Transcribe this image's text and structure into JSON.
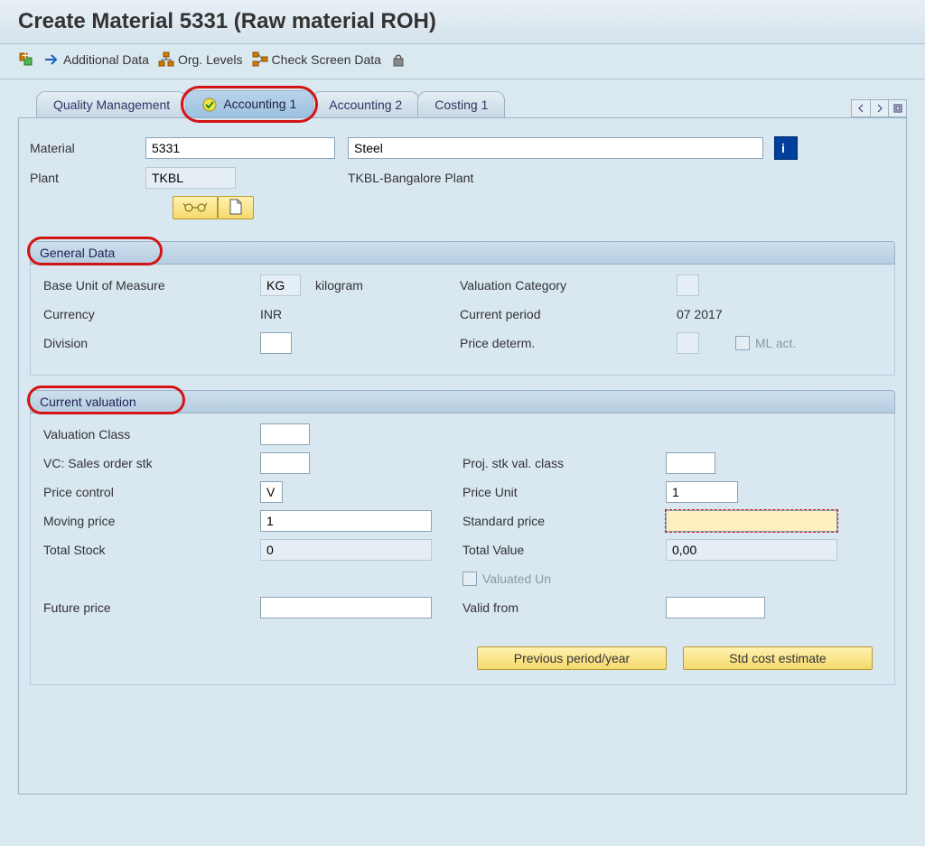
{
  "title": "Create Material 5331 (Raw material ROH)",
  "toolbar": {
    "additional_data": "Additional Data",
    "org_levels": "Org. Levels",
    "check_screen": "Check Screen Data"
  },
  "tabs": {
    "t1": "Quality Management",
    "t2": "Accounting 1",
    "t3": "Accounting 2",
    "t4": "Costing 1"
  },
  "header": {
    "material_label": "Material",
    "material_value": "5331",
    "material_desc": "Steel",
    "plant_label": "Plant",
    "plant_value": "TKBL",
    "plant_desc": "TKBL-Bangalore Plant"
  },
  "sections": {
    "general": {
      "title": "General Data",
      "base_uom_label": "Base Unit of Measure",
      "base_uom_value": "KG",
      "base_uom_text": "kilogram",
      "valuation_cat_label": "Valuation Category",
      "valuation_cat_value": "",
      "currency_label": "Currency",
      "currency_value": "INR",
      "current_period_label": "Current period",
      "current_period_value": "07 2017",
      "division_label": "Division",
      "division_value": "",
      "price_determ_label": "Price determ.",
      "price_determ_value": "",
      "ml_act_label": "ML act."
    },
    "valuation": {
      "title": "Current valuation",
      "valuation_class_label": "Valuation Class",
      "valuation_class_value": "",
      "vc_sales_label": "VC: Sales order stk",
      "vc_sales_value": "",
      "proj_stk_label": "Proj. stk val. class",
      "proj_stk_value": "",
      "price_control_label": "Price control",
      "price_control_value": "V",
      "price_unit_label": "Price Unit",
      "price_unit_value": "1",
      "moving_price_label": "Moving price",
      "moving_price_value": "1",
      "standard_price_label": "Standard price",
      "standard_price_value": "",
      "total_stock_label": "Total Stock",
      "total_stock_value": "0",
      "total_value_label": "Total Value",
      "total_value_value": "0,00",
      "valuated_un_label": "Valuated Un",
      "future_price_label": "Future price",
      "future_price_value": "",
      "valid_from_label": "Valid from",
      "valid_from_value": "",
      "btn_prev_period": "Previous period/year",
      "btn_std_cost": "Std cost estimate"
    }
  }
}
